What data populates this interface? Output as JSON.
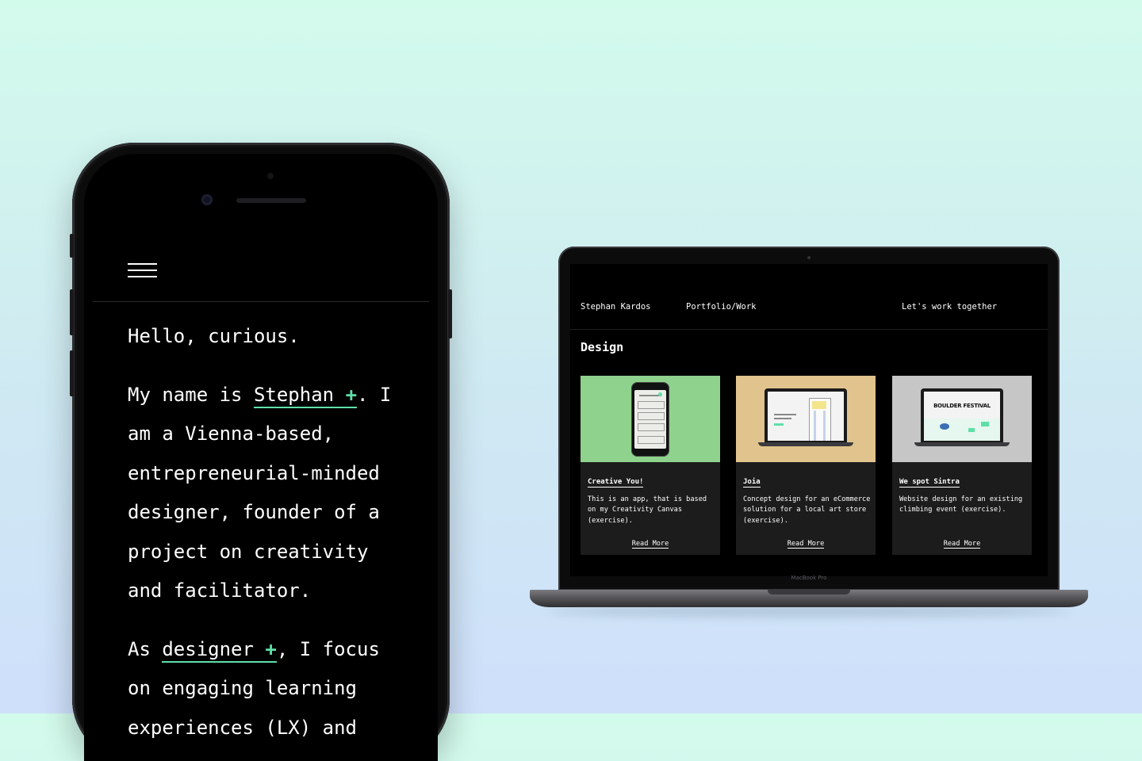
{
  "colors": {
    "accent": "#5ee0a8",
    "background_top": "#d3fbec",
    "background_bottom": "#cfe0fb",
    "screen_bg": "#000000",
    "card_bg": "#1c1c1c",
    "thumb_creative": "#8fd28d",
    "thumb_joia": "#e1c48d",
    "thumb_sintra": "#c6c6c6"
  },
  "phone": {
    "menu_icon": "hamburger-icon",
    "greeting": "Hello, curious.",
    "para1": {
      "before": "My name is ",
      "link_text": "Stephan",
      "link_icon": "+",
      "after": ". I am a Vienna-based, entrepreneurial-minded designer, founder of a project on creativity and facilitator."
    },
    "para2": {
      "before": "As ",
      "link_text": "designer",
      "link_icon": "+",
      "after": ", I focus on engaging learning experiences (LX) and"
    }
  },
  "laptop": {
    "brand": "MacBook Pro",
    "nav": {
      "name": "Stephan Kardos",
      "portfolio": "Portfolio/Work",
      "contact": "Let's work together"
    },
    "section_title": "Design",
    "cards": [
      {
        "title": "Creative You!",
        "description": "This is an app, that is based on my Creativity Canvas (exercise).",
        "cta": "Read More",
        "thumb": "phone-mockup"
      },
      {
        "title": "Joia",
        "description": "Concept design for an eCommerce solution for a local art store (exercise).",
        "cta": "Read More",
        "thumb": "laptop-mockup"
      },
      {
        "title": "We spot Sintra",
        "description": "Website design for an existing climbing event (exercise).",
        "cta": "Read More",
        "thumb": "laptop-mockup"
      }
    ],
    "sintra_thumb_text": "BOULDER FESTIVAL"
  }
}
